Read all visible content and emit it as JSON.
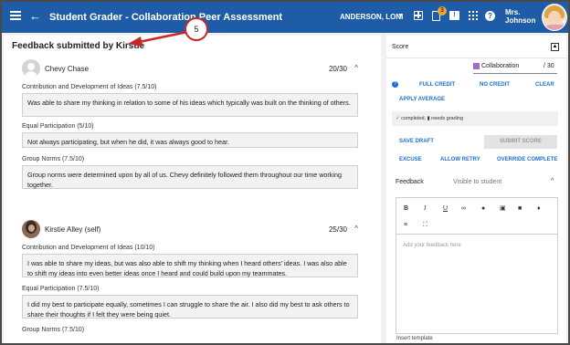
{
  "header": {
    "title": "Student Grader - Collaboration Peer Assessment",
    "student_name": "ANDERSON, LONI",
    "badge_count": "3",
    "user_name_line1": "Mrs.",
    "user_name_line2": "Johnson"
  },
  "left": {
    "title": "Feedback submitted by Kirstie",
    "students": [
      {
        "name": "Chevy Chase",
        "score": "20/30",
        "criteria": [
          {
            "label": "Contribution and Development of Ideas (7.5/10)",
            "text": "Was able to share my thinking in relation to some of his ideas which typically was built on the thinking of others."
          },
          {
            "label": "Equal Participation (5/10)",
            "text": "Not always participating, but when he did, it was always good to hear."
          },
          {
            "label": "Group Norms (7.5/10)",
            "text": "Group norms were determined upon by all of us. Chevy definitely followed them throughout our time working together."
          }
        ]
      },
      {
        "name": "Kirstie Alley (self)",
        "score": "25/30",
        "criteria": [
          {
            "label": "Contribution and Development of Ideas (10/10)",
            "text": "I was able to share my ideas, but was also able to shift my thinking when I heard others' ideas. I was also able to shift my ideas into even better ideas once I heard and could build upon my teammates."
          },
          {
            "label": "Equal Participation (7.5/10)",
            "text": "I did my best to participate equally, sometimes I can struggle to share the air. I also did my best to ask others to share their thoughts if I felt they were being quiet."
          },
          {
            "label": "Group Norms (7.5/10)",
            "text": ""
          }
        ]
      }
    ]
  },
  "callout": {
    "number": "5",
    "color": "#c62828"
  },
  "right": {
    "score_title": "Score",
    "rubric_label": "Collaboration",
    "rubric_total": "/ 30",
    "full_credit": "FULL CREDIT",
    "no_credit": "NO CREDIT",
    "clear": "CLEAR",
    "apply_average": "APPLY AVERAGE",
    "status_completed": "completed,",
    "status_needs": "needs grading",
    "save_draft": "SAVE DRAFT",
    "submit_score": "SUBMIT SCORE",
    "excuse": "EXCUSE",
    "allow_retry": "ALLOW RETRY",
    "override_complete": "OVERRIDE COMPLETE",
    "feedback_label": "Feedback",
    "visible_to_student": "Visible to student",
    "feedback_placeholder": "Add your feedback here",
    "insert_template": "Insert template"
  },
  "colors": {
    "brand": "#1f5ca8",
    "link": "#1f6fd1",
    "accent": "#a36cc4"
  }
}
